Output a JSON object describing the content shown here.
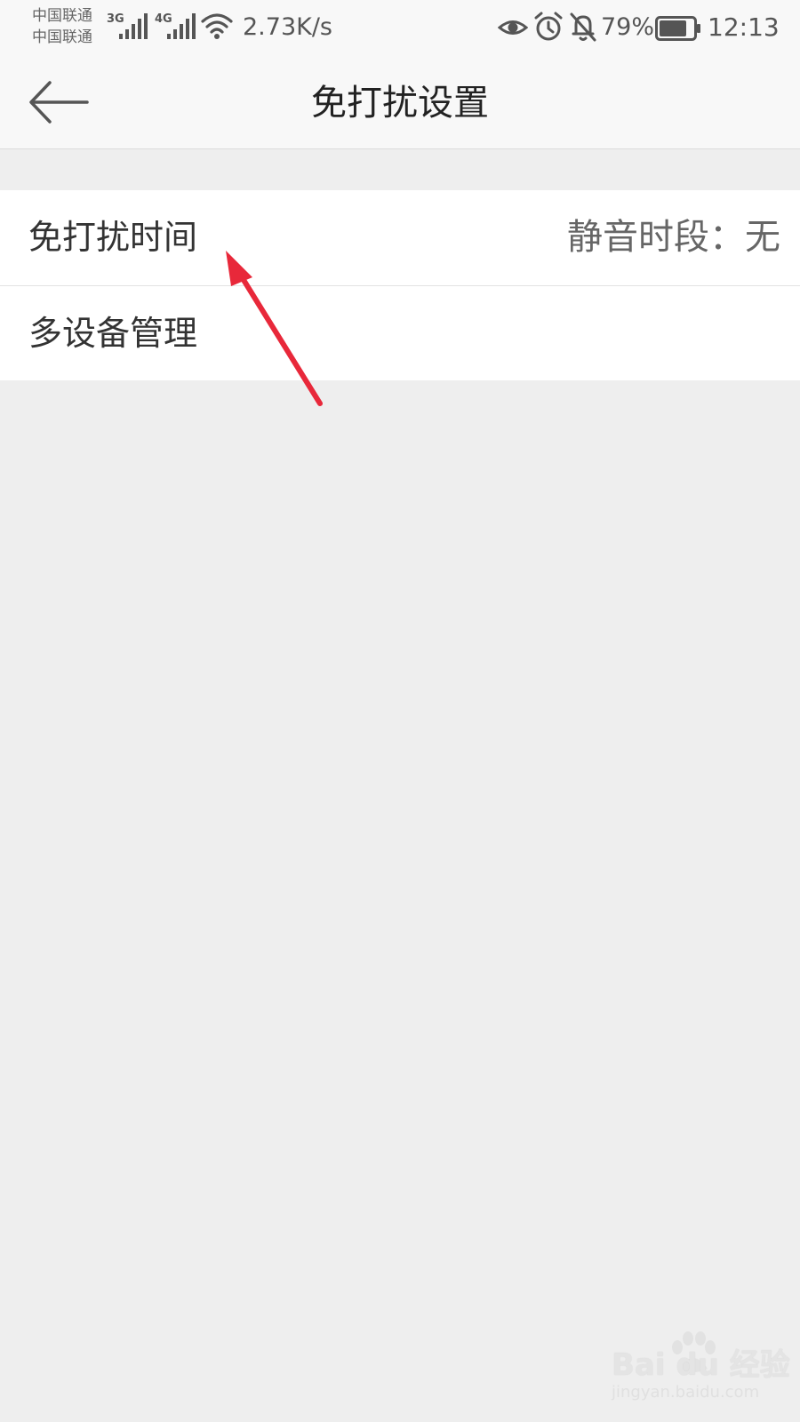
{
  "status_bar": {
    "carriers": [
      "中国联通",
      "中国联通"
    ],
    "signal_1_label": "3G",
    "signal_2_label": "4G",
    "net_speed": "2.73K/s",
    "battery_percent": "79%",
    "battery_level": 0.79,
    "time": "12:13",
    "icons": [
      "signal-icon",
      "wifi-icon",
      "eye-icon",
      "alarm-icon",
      "mute-bell-icon",
      "battery-icon"
    ]
  },
  "nav": {
    "back_icon": "back-arrow-icon",
    "title": "免打扰设置"
  },
  "settings": {
    "items": [
      {
        "label": "免打扰时间",
        "value": "静音时段：无"
      },
      {
        "label": "多设备管理",
        "value": ""
      }
    ]
  },
  "annotation": {
    "color": "#e8283a",
    "points_to": "免打扰时间"
  },
  "watermark": {
    "brand": "Bai  du 经验",
    "site": "jingyan.baidu.com"
  },
  "colors": {
    "background": "#eeeeee",
    "bar_background": "#f8f8f8",
    "row_background": "#ffffff",
    "accent_arrow": "#e8283a"
  }
}
